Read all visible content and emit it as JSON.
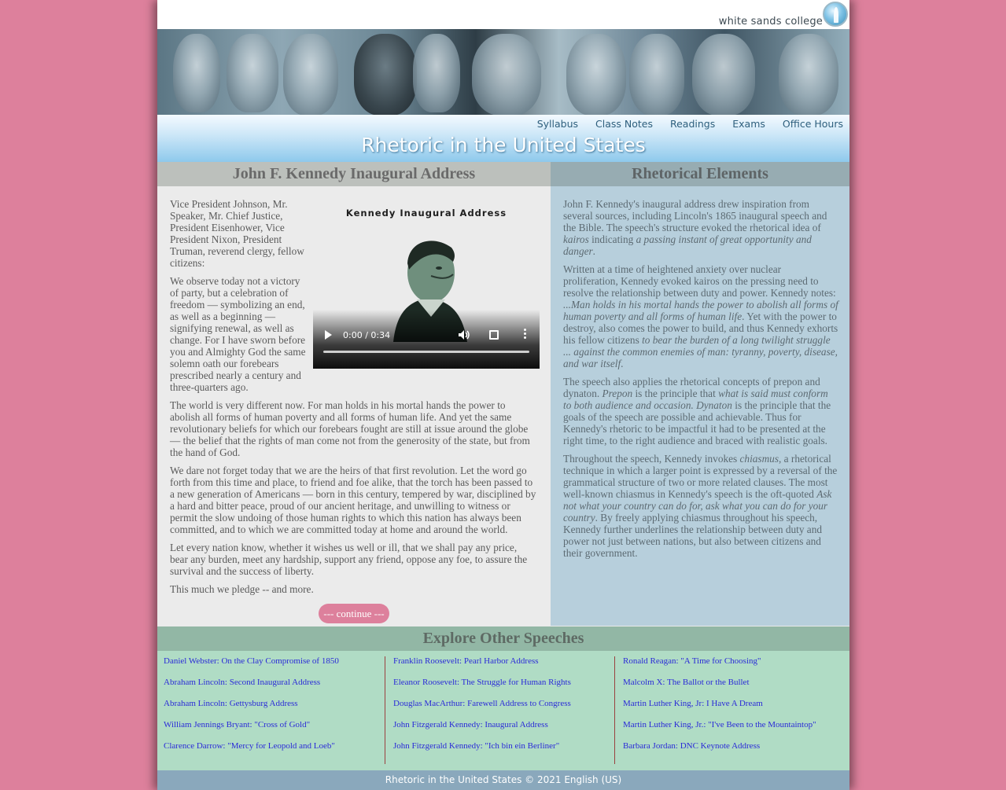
{
  "brand": {
    "name": "white sands college"
  },
  "nav": [
    "Syllabus",
    "Class Notes",
    "Readings",
    "Exams",
    "Office Hours"
  ],
  "site_title": "Rhetoric in the United States",
  "left": {
    "heading": "John F. Kennedy Inaugural Address",
    "video": {
      "title": "Kennedy Inaugural Address",
      "time": "0:00 / 0:34"
    },
    "paragraphs": [
      "Vice President Johnson, Mr. Speaker, Mr. Chief Justice, President Eisenhower, Vice President Nixon, President Truman, reverend clergy, fellow citizens:",
      "We observe today not a victory of party, but a celebration of freedom — symbolizing an end, as well as a beginning — signifying renewal, as well as change. For I have sworn before you and Almighty God the same solemn oath our forebears prescribed nearly a century and three-quarters ago.",
      "The world is very different now. For man holds in his mortal hands the power to abolish all forms of human poverty and all forms of human life. And yet the same revolutionary beliefs for which our forebears fought are still at issue around the globe — the belief that the rights of man come not from the generosity of the state, but from the hand of God.",
      "We dare not forget today that we are the heirs of that first revolution. Let the word go forth from this time and place, to friend and foe alike, that the torch has been passed to a new generation of Americans — born in this century, tempered by war, disciplined by a hard and bitter peace, proud of our ancient heritage, and unwilling to witness or permit the slow undoing of those human rights to which this nation has always been committed, and to which we are committed today at home and around the world.",
      "Let every nation know, whether it wishes us well or ill, that we shall pay any price, bear any burden, meet any hardship, support any friend, oppose any foe, to assure the survival and the success of liberty.",
      "This much we pledge -- and more."
    ],
    "continue_label": "--- continue ---"
  },
  "right": {
    "heading": "Rhetorical Elements",
    "p1": {
      "a": "John F. Kennedy's inaugural address drew inspiration from several sources, including Lincoln's 1865 inaugural speech and the Bible. The speech's structure evoked the rhetorical idea of ",
      "b": "kairos",
      "c": " indicating ",
      "d": "a passing instant of great opportunity and danger",
      "e": "."
    },
    "p2": {
      "a": "Written at a time of heightened anxiety over nuclear proliferation, Kennedy evoked kairos on the pressing need to resolve the relationship between duty and power. Kennedy notes: ",
      "b": "...Man holds in his mortal hands the power to abolish all forms of human poverty and all forms of human life",
      "c": ". Yet with the power to destroy, also comes the power to build, and thus Kennedy exhorts his fellow citizens ",
      "d": "to bear the burden of a long twilight struggle ... against the common enemies of man: tyranny, poverty, disease, and war itself",
      "e": "."
    },
    "p3": {
      "a": "The speech also applies the rhetorical concepts of prepon and dynaton. ",
      "b": "Prepon",
      "c": " is the principle that ",
      "d": "what is said must conform to both audience and occasion. Dynaton",
      "e": " is the principle that the goals of the speech are possible and achievable. Thus for Kennedy's rhetoric to be impactful it had to be presented at the right time, to the right audience and braced with realistic goals."
    },
    "p4": {
      "a": "Throughout the speech, Kennedy invokes ",
      "b": "chiasmus",
      "c": ", a rhetorical technique in which a larger point is expressed by a reversal of the grammatical structure of two or more related clauses. The most well-known chiasmus in Kennedy's speech is the oft-quoted ",
      "d": "Ask not what your country can do for, ask what you can do for your country",
      "e": ". By freely applying chiasmus throughout his speech, Kennedy further underlines the relationship between duty and power not just between nations, but also between citizens and their government."
    }
  },
  "explore": {
    "heading": "Explore Other Speeches",
    "col1": [
      "Daniel Webster: On the Clay Compromise of 1850",
      "Abraham Lincoln: Second Inaugural Address",
      "Abraham Lincoln: Gettysburg Address",
      "William Jennings Bryant: \"Cross of Gold\"",
      "Clarence Darrow: \"Mercy for Leopold and Loeb\""
    ],
    "col2": [
      "Franklin Roosevelt: Pearl Harbor Address",
      "Eleanor Roosevelt: The Struggle for Human Rights",
      "Douglas MacArthur: Farewell Address to Congress",
      "John Fitzgerald Kennedy: Inaugural Address",
      "John Fitzgerald Kennedy: \"Ich bin ein Berliner\""
    ],
    "col3": [
      "Ronald Reagan: \"A Time for Choosing\"",
      "Malcolm X: The Ballot or the Bullet",
      "Martin Luther King, Jr: I Have A Dream",
      "Martin Luther King, Jr.: \"I've Been to the Mountaintop\"",
      "Barbara Jordan: DNC Keynote Address"
    ]
  },
  "footer": "Rhetoric in the United States © 2021 English (US)",
  "colors": {
    "background": "#dd809c",
    "accent": "#8ec9ec",
    "explore": "#b0dcc5",
    "link": "#2a2ad8"
  }
}
